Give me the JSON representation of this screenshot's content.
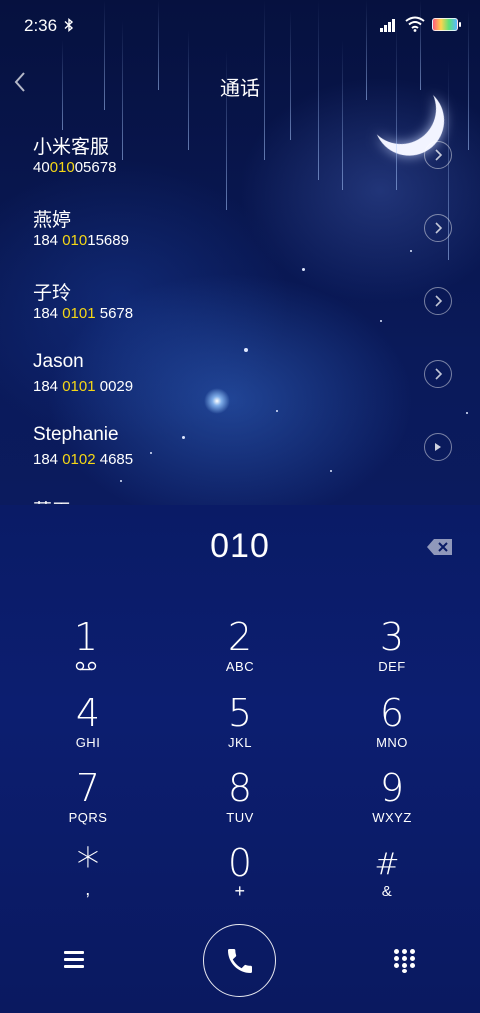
{
  "status_bar": {
    "time": "2:36",
    "bluetooth_icon": "bluetooth-icon",
    "signal_icon": "signal-icon",
    "wifi_icon": "wifi-icon",
    "battery_icon": "battery-icon"
  },
  "header": {
    "title": "通话",
    "back_icon": "chevron-left-icon"
  },
  "contacts": [
    {
      "name": "小米客服",
      "number_pre": "40",
      "number_hl": "010",
      "number_post": "05678"
    },
    {
      "name": "燕婷",
      "number_pre": "184 ",
      "number_hl": "010",
      "number_post": "15689"
    },
    {
      "name": "子玲",
      "number_pre": "184 ",
      "number_hl": "0101",
      "number_post": " 5678"
    },
    {
      "name": "Jason",
      "number_pre": "184 ",
      "number_hl": "0101",
      "number_post": " 0029"
    },
    {
      "name": "Stephanie",
      "number_pre": "184 ",
      "number_hl": "0102",
      "number_post": " 4685"
    }
  ],
  "partial_contact": {
    "name": "萧玉"
  },
  "dialer": {
    "input_value": "010",
    "keys": [
      {
        "digit": "1",
        "letters": ""
      },
      {
        "digit": "2",
        "letters": "ABC"
      },
      {
        "digit": "3",
        "letters": "DEF"
      },
      {
        "digit": "4",
        "letters": "GHI"
      },
      {
        "digit": "5",
        "letters": "JKL"
      },
      {
        "digit": "6",
        "letters": "MNO"
      },
      {
        "digit": "7",
        "letters": "PQRS"
      },
      {
        "digit": "8",
        "letters": "TUV"
      },
      {
        "digit": "9",
        "letters": "WXYZ"
      },
      {
        "digit": "*",
        "letters": ","
      },
      {
        "digit": "0",
        "letters": "+"
      },
      {
        "digit": "#",
        "letters": "&"
      }
    ]
  },
  "colors": {
    "highlight": "#f5d716",
    "background": "#0a1b66"
  }
}
